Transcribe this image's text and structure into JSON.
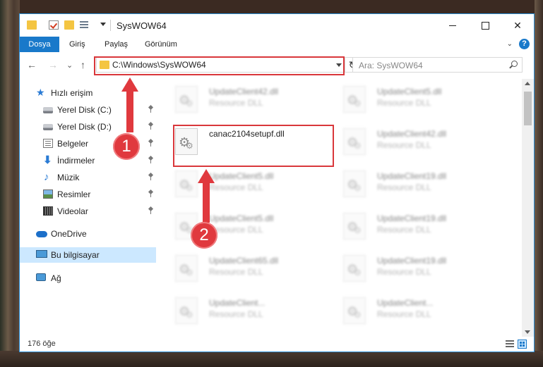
{
  "window": {
    "title": "SysWOW64",
    "close_glyph": "✕"
  },
  "ribbon": {
    "tabs": [
      "Dosya",
      "Giriş",
      "Paylaş",
      "Görünüm"
    ],
    "help": "?",
    "chevron": "⌄"
  },
  "nav": {
    "back": "←",
    "forward": "→",
    "recent": "⌄",
    "up": "↑",
    "address": "C:\\Windows\\SysWOW64",
    "refresh": "↻",
    "search_placeholder": "Ara: SysWOW64"
  },
  "sidebar": {
    "items": [
      {
        "label": "Hızlı erişim",
        "icon": "star-icon"
      },
      {
        "label": "Yerel Disk (C:)",
        "icon": "disk-icon",
        "pinned": true
      },
      {
        "label": "Yerel Disk (D:)",
        "icon": "disk-icon",
        "pinned": true
      },
      {
        "label": "Belgeler",
        "icon": "documents-icon",
        "pinned": true
      },
      {
        "label": "İndirmeler",
        "icon": "download-icon",
        "pinned": true
      },
      {
        "label": "Müzik",
        "icon": "music-icon",
        "pinned": true
      },
      {
        "label": "Resimler",
        "icon": "pictures-icon",
        "pinned": true
      },
      {
        "label": "Videolar",
        "icon": "video-icon",
        "pinned": true
      },
      {
        "label": "OneDrive",
        "icon": "cloud-icon"
      },
      {
        "label": "Bu bilgisayar",
        "icon": "computer-icon",
        "selected": true
      },
      {
        "label": "Ağ",
        "icon": "network-icon"
      }
    ]
  },
  "files": {
    "left": [
      {
        "name": "UpdateClient42.dll",
        "type": "Resource DLL"
      },
      {
        "name": "canac2104setupf.dll",
        "type": ""
      },
      {
        "name": "UpdateClient5.dll",
        "type": "Resource DLL"
      },
      {
        "name": "UpdateClient5.dll",
        "type": "Resource DLL"
      },
      {
        "name": "UpdateClient65.dll",
        "type": "Resource DLL"
      },
      {
        "name": "UpdateClient...",
        "type": "Resource DLL"
      }
    ],
    "right": [
      {
        "name": "UpdateClient5.dll",
        "type": "Resource DLL"
      },
      {
        "name": "UpdateClient42.dll",
        "type": "Resource DLL"
      },
      {
        "name": "UpdateClient19.dll",
        "type": "Resource DLL"
      },
      {
        "name": "UpdateClient19.dll",
        "type": "Resource DLL"
      },
      {
        "name": "UpdateClient19.dll",
        "type": "Resource DLL"
      },
      {
        "name": "UpdateClient...",
        "type": "Resource DLL"
      }
    ]
  },
  "status": {
    "count": "176 öğe"
  },
  "annotations": {
    "badge_1": "1",
    "badge_2": "2",
    "color": "#e0393e"
  }
}
